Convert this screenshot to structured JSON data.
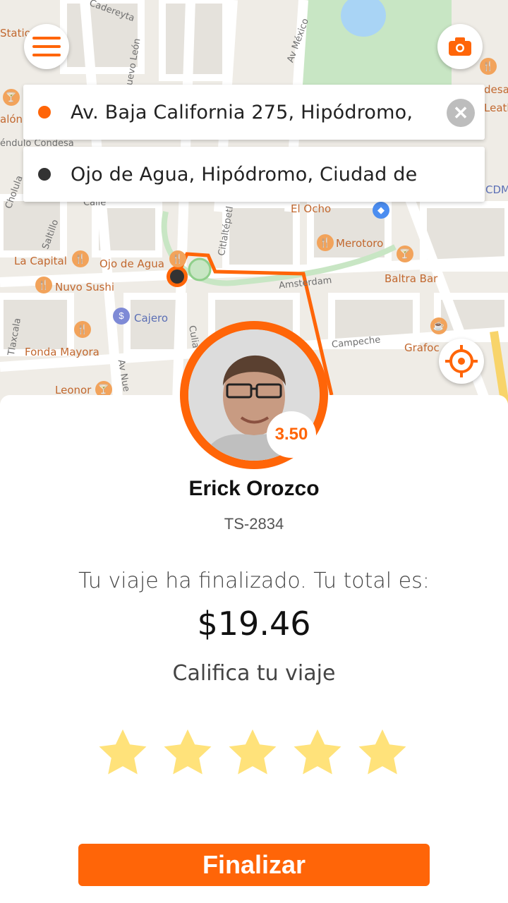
{
  "map": {
    "labels": {
      "el_ocho": "El Ocho",
      "merotoro": "Merotoro",
      "baltra_bar": "Baltra Bar",
      "la_capital": "La Capital",
      "ojo_de_agua": "Ojo de Agua",
      "nuvo_sushi": "Nuvo Sushi",
      "cajero": "Cajero",
      "fonda_mayora": "Fonda Mayora",
      "grafoc": "Grafoc",
      "leonor": "Leonor",
      "amsterdam": "Amsterdam",
      "campeche": "Campeche",
      "av_mexico": "Av México",
      "cadereyta": "Cadereyta",
      "nuevo_leon": "Nuevo León",
      "citlaltepetl": "Citlaltépetl",
      "pendulo": "éndulo Condesa",
      "salon": "alón",
      "station": "Statio",
      "desa": "desa",
      "leath": "Leath",
      "cdm": "CDM",
      "cholula": "Cholula",
      "saltillo": "Saltillo",
      "tlaxcala": "Tlaxcala",
      "calle": "Calle",
      "av_nue": "Av Nue",
      "culiacan": "Culia"
    }
  },
  "header": {
    "menu_icon": "hamburger-menu-icon",
    "camera_icon": "camera-icon",
    "locate_icon": "crosshair-icon"
  },
  "route": {
    "origin": "Av. Baja California 275, Hipódromo,",
    "destination": "Ojo de Agua, Hipódromo, Ciudad de"
  },
  "driver": {
    "name": "Erick Orozco",
    "plate": "TS-2834",
    "rating": "3.50"
  },
  "trip": {
    "message": "Tu viaje ha finalizado. Tu total es:",
    "total": "$19.46",
    "rate_label": "Califica tu viaje",
    "stars": 5
  },
  "actions": {
    "finish_label": "Finalizar"
  },
  "colors": {
    "accent": "#ff6508",
    "star": "#ffe27a",
    "park": "#c8e6c4"
  }
}
